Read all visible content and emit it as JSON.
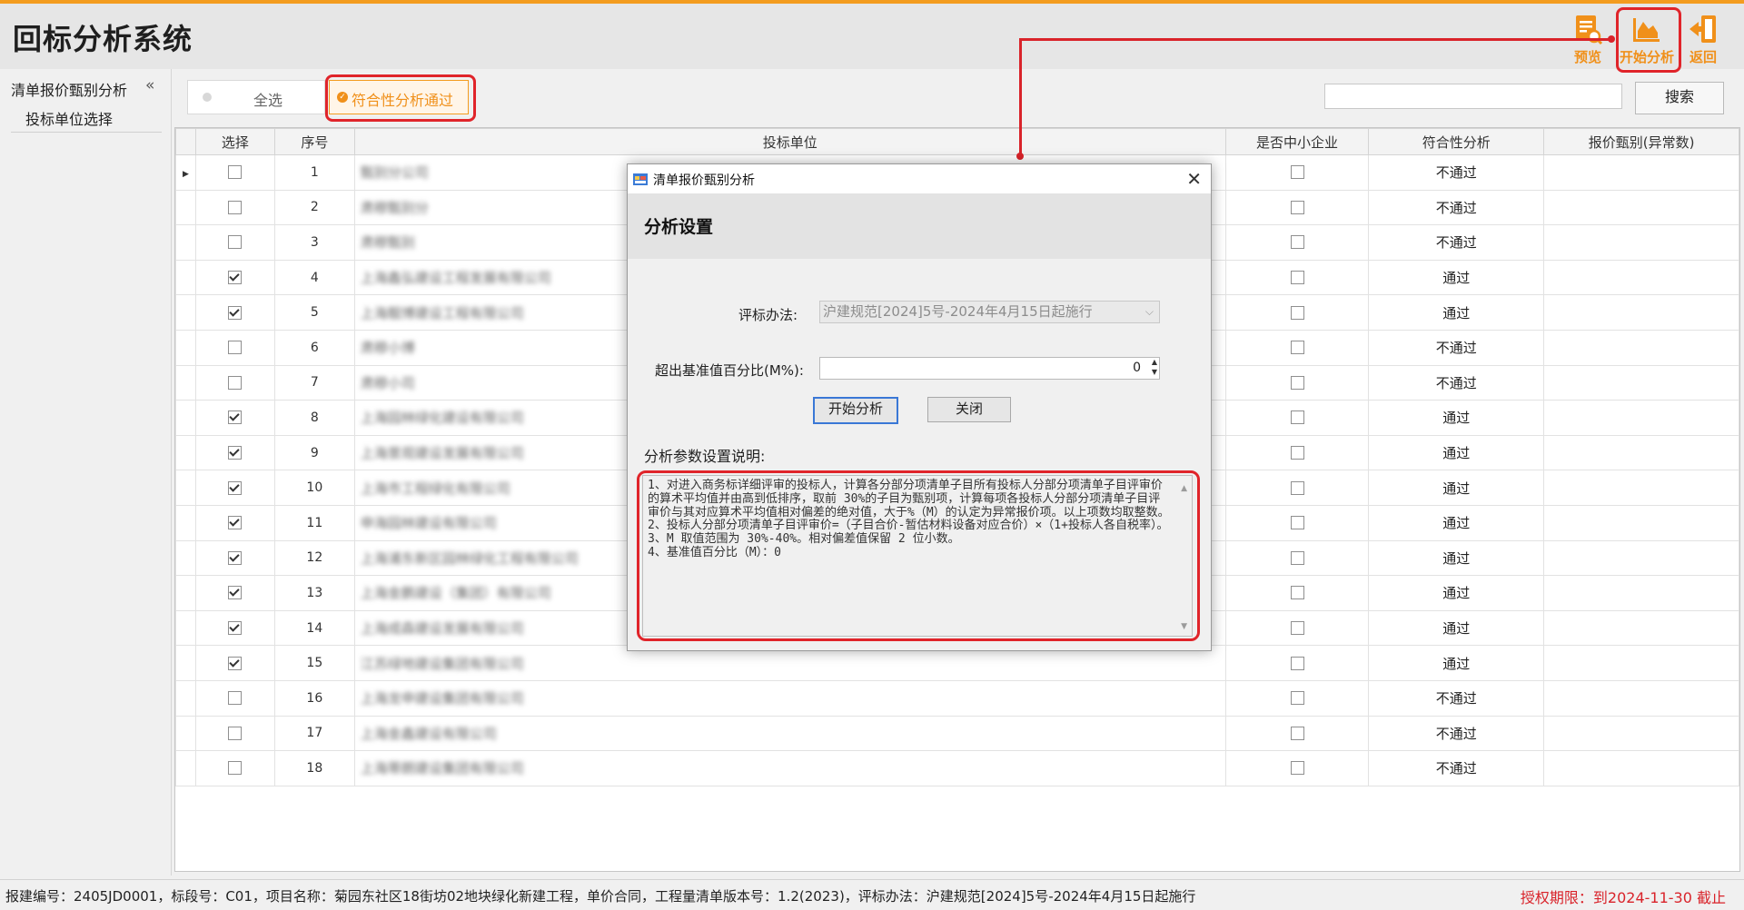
{
  "app": {
    "title": "回标分析系统"
  },
  "toolbar": [
    {
      "label": "预览",
      "icon": "preview-doc-icon"
    },
    {
      "label": "开始分析",
      "icon": "analysis-chart-icon"
    },
    {
      "label": "返回",
      "icon": "return-exit-icon"
    }
  ],
  "sidebar": {
    "title": "清单报价甄别分析",
    "collapse": "«",
    "items": [
      {
        "label": "投标单位选择"
      }
    ]
  },
  "filter": {
    "all_label": "全选",
    "pass_label": "符合性分析通过",
    "search_value": "",
    "search_button": "搜索"
  },
  "grid": {
    "columns": [
      "选择",
      "序号",
      "投标单位",
      "是否中小企业",
      "符合性分析",
      "报价甄别(异常数)"
    ],
    "rows": [
      {
        "selected": false,
        "seq": "1",
        "unit": "甄别分公司",
        "sme": false,
        "status": "不通过"
      },
      {
        "selected": false,
        "seq": "2",
        "unit": "肃穆甄别分",
        "sme": false,
        "status": "不通过"
      },
      {
        "selected": false,
        "seq": "3",
        "unit": "肃穆甄别",
        "sme": false,
        "status": "不通过"
      },
      {
        "selected": true,
        "seq": "4",
        "unit": "上海鑫弘建设工程发展有限公司",
        "sme": false,
        "status": "通过"
      },
      {
        "selected": true,
        "seq": "5",
        "unit": "上海靓博建设工程有限公司",
        "sme": false,
        "status": "通过"
      },
      {
        "selected": false,
        "seq": "6",
        "unit": "肃穆小博",
        "sme": false,
        "status": "不通过"
      },
      {
        "selected": false,
        "seq": "7",
        "unit": "肃穆小司",
        "sme": false,
        "status": "不通过"
      },
      {
        "selected": true,
        "seq": "8",
        "unit": "上海园林绿化建设有限公司",
        "sme": false,
        "status": "通过"
      },
      {
        "selected": true,
        "seq": "9",
        "unit": "上海景观建设发展有限公司",
        "sme": false,
        "status": "通过"
      },
      {
        "selected": true,
        "seq": "10",
        "unit": "上海市工程绿化有限公司",
        "sme": false,
        "status": "通过"
      },
      {
        "selected": true,
        "seq": "11",
        "unit": "申海园林建设有限公司",
        "sme": false,
        "status": "通过"
      },
      {
        "selected": true,
        "seq": "12",
        "unit": "上海浦东新区园林绿化工程有限公司",
        "sme": false,
        "status": "通过"
      },
      {
        "selected": true,
        "seq": "13",
        "unit": "上海金鹏建设（集团）有限公司",
        "sme": false,
        "status": "通过"
      },
      {
        "selected": true,
        "seq": "14",
        "unit": "上海成森建设发展有限公司",
        "sme": false,
        "status": "通过"
      },
      {
        "selected": true,
        "seq": "15",
        "unit": "江苏绿地建设集团有限公司",
        "sme": false,
        "status": "通过"
      },
      {
        "selected": false,
        "seq": "16",
        "unit": "上海龙申建设集团有限公司",
        "sme": false,
        "status": "不通过"
      },
      {
        "selected": false,
        "seq": "17",
        "unit": "上海金鑫建设有限公司",
        "sme": false,
        "status": "不通过"
      },
      {
        "selected": false,
        "seq": "18",
        "unit": "上海蒂朗建设集团有限公司",
        "sme": false,
        "status": "不通过"
      }
    ]
  },
  "dialog": {
    "title": "清单报价甄别分析",
    "heading": "分析设置",
    "method_label": "评标办法:",
    "method_value": "沪建规范[2024]5号-2024年4月15日起施行",
    "percent_label": "超出基准值百分比(M%):",
    "percent_value": "0",
    "start_button": "开始分析",
    "close_button": "关闭",
    "desc_label": "分析参数设置说明:",
    "notes": "1、对进入商务标详细评审的投标人，计算各分部分项清单子目所有投标人分部分项清单子目评审价的算术平均值并由高到低排序，取前 30%的子目为甄别项，计算每项各投标人分部分项清单子目评审价与其对应算术平均值相对偏差的绝对值，大于%（M）的认定为异常报价项。以上项数均取整数。\n2、投标人分部分项清单子目评审价=（子目合价-暂估材料设备对应合价）×（1+投标人各自税率）。\n3、M 取值范围为 30%-40%。相对偏差值保留 2 位小数。\n4、基准值百分比（M）：0"
  },
  "statusbar": {
    "info": "报建编号：2405JD0001，标段号：C01，项目名称：菊园东社区18街坊02地块绿化新建工程，单价合同，工程量清单版本号：1.2(2023)，评标办法：沪建规范[2024]5号-2024年4月15日起施行",
    "license": "授权期限：到2024-11-30 截止"
  },
  "colors": {
    "accent": "#f0901a",
    "highlight": "#e0242a",
    "license": "#d9232a"
  }
}
